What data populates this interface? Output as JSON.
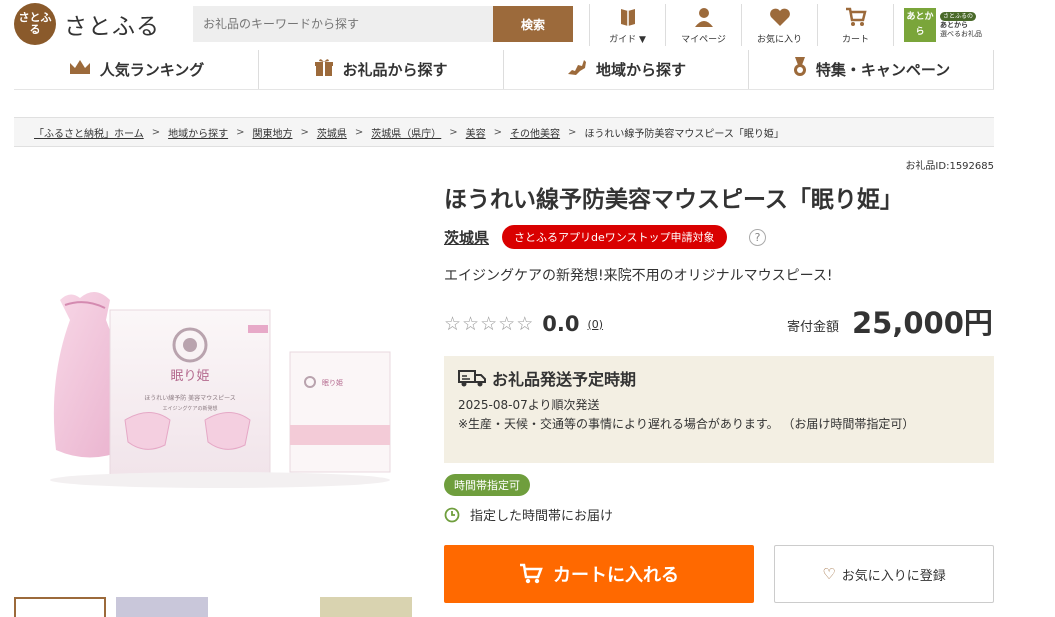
{
  "logo": {
    "mark": "さとふる",
    "text": "さとふる"
  },
  "search": {
    "placeholder": "お礼品のキーワードから探す",
    "button_label": "検索"
  },
  "topnav": [
    {
      "label": "ガイド ▼",
      "icon": "guide-book-icon"
    },
    {
      "label": "マイページ",
      "icon": "person-icon"
    },
    {
      "label": "お気に入り",
      "icon": "heart-icon"
    },
    {
      "label": "カート",
      "icon": "cart-icon"
    }
  ],
  "app_banner": {
    "tile": "あとから",
    "line1": "さとふるの",
    "line2": "あとから",
    "line3": "選べるお礼品"
  },
  "mainnav": [
    {
      "label": "人気ランキング",
      "icon": "crown-icon"
    },
    {
      "label": "お礼品から探す",
      "icon": "gift-icon"
    },
    {
      "label": "地域から探す",
      "icon": "map-icon"
    },
    {
      "label": "特集・キャンペーン",
      "icon": "medal-icon"
    }
  ],
  "breadcrumb": [
    "「ふるさと納税」ホーム",
    "地域から探す",
    "関東地方",
    "茨城県",
    "茨城県（県庁）",
    "美容",
    "その他美容"
  ],
  "breadcrumb_current": "ほうれい線予防美容マウスピース「眠り姫」",
  "product": {
    "gift_id": "お礼品ID:1592685",
    "title": "ほうれい線予防美容マウスピース「眠り姫」",
    "prefecture": "茨城県",
    "app_badge": "さとふるアプリdeワンストップ申請対象",
    "help": "?",
    "catch": "エイジングケアの新発想!来院不用のオリジナルマウスピース!",
    "rating": "0.0",
    "review_count": "(0)",
    "rating_stars": 0,
    "price_label": "寄付金額",
    "price": "25,000円",
    "box_brand": "眠り姫",
    "box_line": "ほうれい線予防 美容マウスピース",
    "box_sub": "エイジングケアの新発想"
  },
  "shipping": {
    "title": "お礼品発送予定時期",
    "date": "2025-08-07より順次発送",
    "note": "※生産・天候・交通等の事情により遅れる場合があります。 （お届け時間帯指定可）"
  },
  "delivery": {
    "badge": "時間帯指定可",
    "text": "指定した時間帯にお届け"
  },
  "actions": {
    "cart": "カートに入れる",
    "favorite": "お気に入りに登録"
  },
  "colors": {
    "accent": "#9c6a3b",
    "cart": "#ff6900",
    "badge_red": "#d90000",
    "badge_green": "#6f9e3d",
    "ship_bg": "#f3efe3"
  }
}
